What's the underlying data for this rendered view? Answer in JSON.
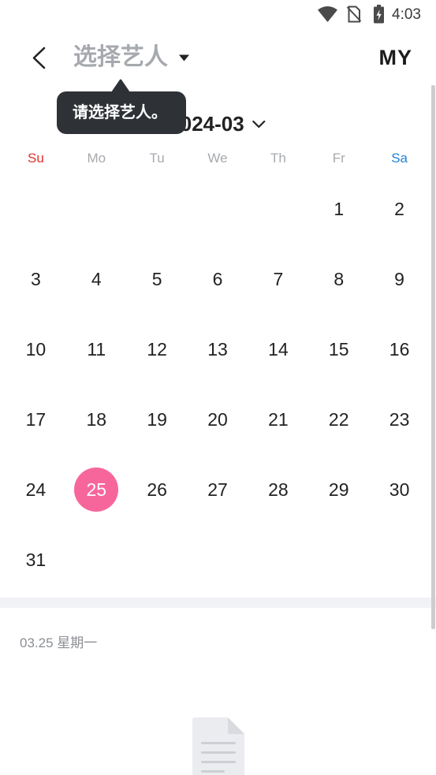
{
  "status_bar": {
    "time": "4:03",
    "icons": [
      "wifi-icon",
      "no-sim-icon",
      "battery-charging-icon"
    ]
  },
  "header": {
    "back_icon": "chevron-left-icon",
    "title": "选择艺人",
    "title_icon": "caret-down-icon",
    "my_label": "MY"
  },
  "tooltip": {
    "text": "请选择艺人。"
  },
  "month_selector": {
    "value": "2024-03",
    "icon": "chevron-down-icon"
  },
  "weekdays": [
    "Su",
    "Mo",
    "Tu",
    "We",
    "Th",
    "Fr",
    "Sa"
  ],
  "calendar": {
    "weeks": [
      [
        null,
        null,
        null,
        null,
        null,
        {
          "day": "1"
        },
        {
          "day": "2"
        }
      ],
      [
        {
          "day": "3"
        },
        {
          "day": "4"
        },
        {
          "day": "5"
        },
        {
          "day": "6"
        },
        {
          "day": "7"
        },
        {
          "day": "8"
        },
        {
          "day": "9"
        }
      ],
      [
        {
          "day": "10"
        },
        {
          "day": "11"
        },
        {
          "day": "12"
        },
        {
          "day": "13"
        },
        {
          "day": "14"
        },
        {
          "day": "15"
        },
        {
          "day": "16"
        }
      ],
      [
        {
          "day": "17"
        },
        {
          "day": "18"
        },
        {
          "day": "19"
        },
        {
          "day": "20"
        },
        {
          "day": "21"
        },
        {
          "day": "22"
        },
        {
          "day": "23"
        }
      ],
      [
        {
          "day": "24"
        },
        {
          "day": "25",
          "selected": true
        },
        {
          "day": "26"
        },
        {
          "day": "27"
        },
        {
          "day": "28"
        },
        {
          "day": "29"
        },
        {
          "day": "30"
        }
      ],
      [
        {
          "day": "31"
        },
        null,
        null,
        null,
        null,
        null,
        null
      ]
    ]
  },
  "selected_date_label": "03.25 星期一",
  "empty_state": {
    "icon": "empty-document-icon"
  },
  "colors": {
    "sunday": "#e0322b",
    "saturday": "#2283d6",
    "weekday": "#a7aaae",
    "selected_day_bg": "#f7669b",
    "title_muted": "#a6a9ae",
    "tooltip_bg": "#2e3236",
    "divider_band": "#f1f2f5"
  }
}
